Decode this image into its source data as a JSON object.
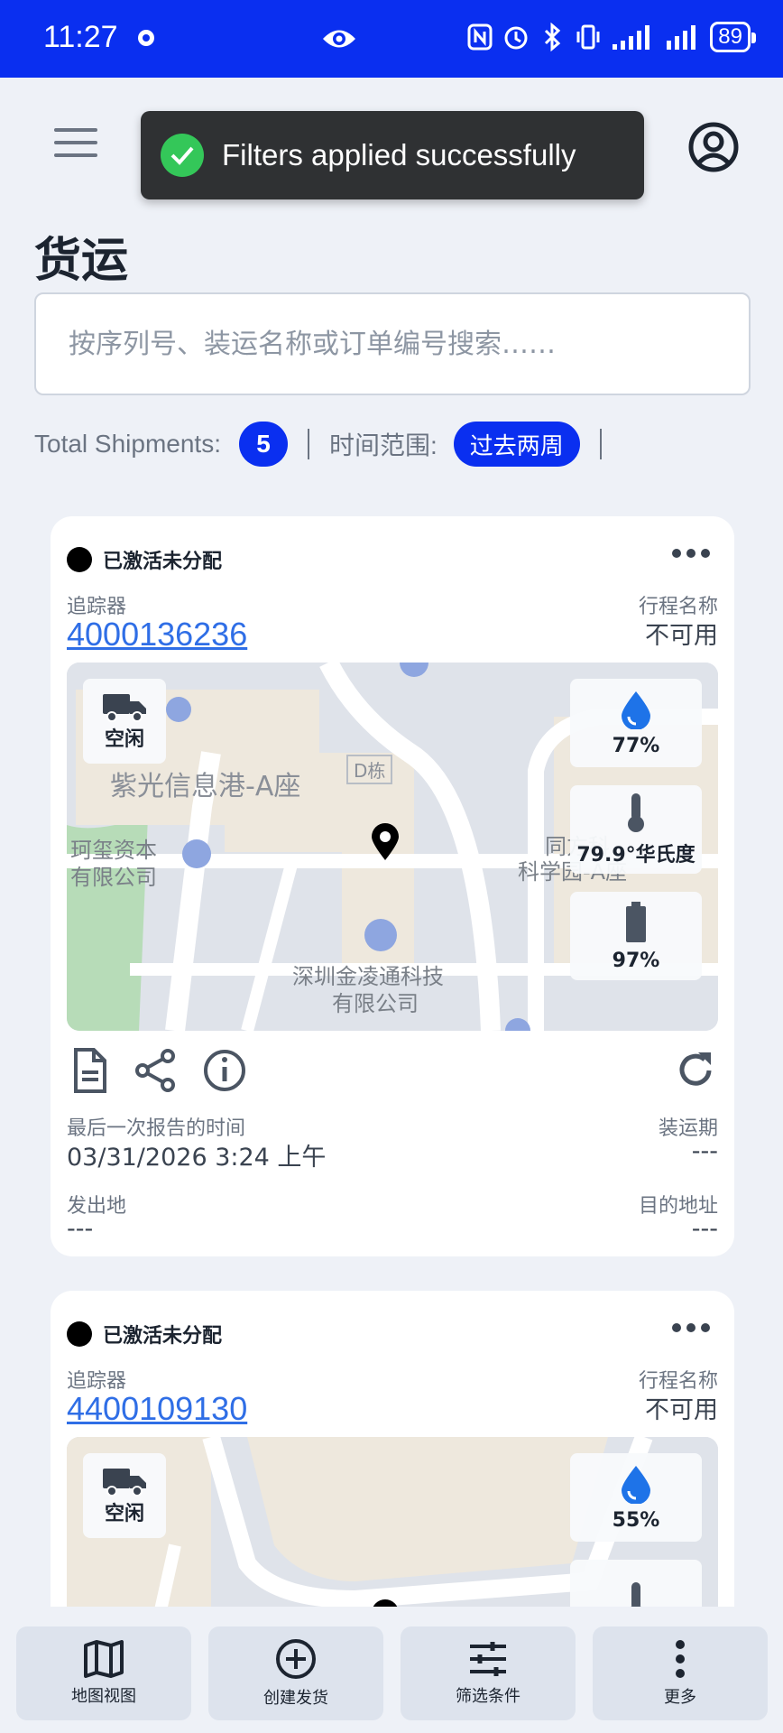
{
  "status_bar": {
    "time": "11:27",
    "battery": "89"
  },
  "toast": {
    "message": "Filters applied successfully"
  },
  "page": {
    "title": "货运"
  },
  "search": {
    "placeholder": "按序列号、装运名称或订单编号搜索……"
  },
  "summary": {
    "total_label": "Total Shipments:",
    "total_count": "5",
    "range_label": "时间范围:",
    "range_value": "过去两周"
  },
  "cards": [
    {
      "status": "已激活未分配",
      "tracker_label": "追踪器",
      "tracker_id": "4000136236",
      "trip_label": "行程名称",
      "trip_value": "不可用",
      "state": "空闲",
      "humidity": "77%",
      "temperature": "79.9°华氏度",
      "battery": "97%",
      "map_labels": {
        "building_a": "紫光信息港-A座",
        "building_d": "D栋",
        "company_1": "深圳金凌通科技",
        "company_1b": "有限公司",
        "company_2": "珂玺资本",
        "company_2b": "有限公司",
        "company_3": "同方科",
        "company_3b": "科学园-A座"
      },
      "last_report_label": "最后一次报告的时间",
      "last_report_value": "03/31/2026 3:24 上午",
      "ship_period_label": "装运期",
      "ship_period_value": "---",
      "origin_label": "发出地",
      "origin_value": "---",
      "destination_label": "目的地址",
      "destination_value": "---"
    },
    {
      "status": "已激活未分配",
      "tracker_label": "追踪器",
      "tracker_id": "4400109130",
      "trip_label": "行程名称",
      "trip_value": "不可用",
      "state": "空闲",
      "humidity": "55%"
    }
  ],
  "bottom_nav": [
    {
      "label": "地图视图",
      "icon": "map-icon"
    },
    {
      "label": "创建发货",
      "icon": "add-circle-icon"
    },
    {
      "label": "筛选条件",
      "icon": "sliders-icon"
    },
    {
      "label": "更多",
      "icon": "more-vertical-icon"
    }
  ],
  "colors": {
    "accent": "#0a2ff0",
    "link": "#2f6ee6",
    "toast_bg": "#2f3133",
    "success": "#34c759"
  }
}
